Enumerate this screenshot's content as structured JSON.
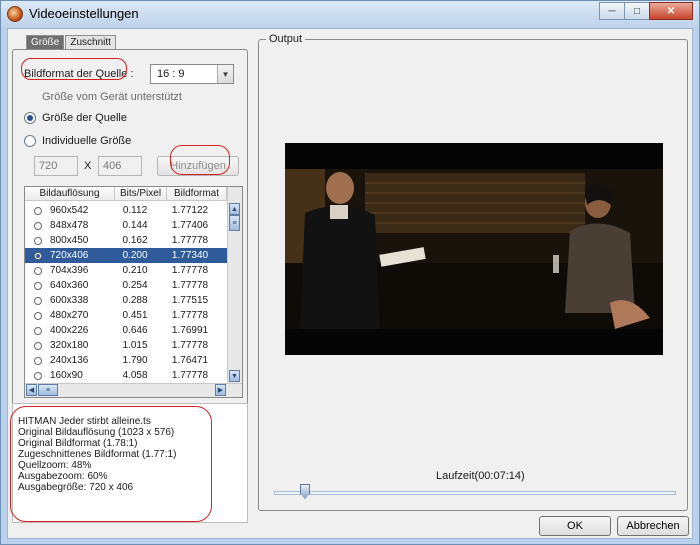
{
  "window": {
    "title": "Videoeinstellungen",
    "buttons": {
      "minimize": "─",
      "maximize": "□",
      "close": "✕"
    }
  },
  "tabs": [
    {
      "label": "Größe",
      "active": true
    },
    {
      "label": "Zuschnitt",
      "active": false
    }
  ],
  "left": {
    "source_format_label": "Bildformat der Quelle :",
    "source_format_value": "16 : 9",
    "supported_note": "Größe vom Gerät unterstützt",
    "radio_source": "Größe der Quelle",
    "radio_custom": "Individuelle Größe",
    "width_value": "720",
    "x_label": "X",
    "height_value": "406",
    "add_button": "Hinzufügen"
  },
  "table": {
    "headers": [
      "Bildauflösung",
      "Bits/Pixel",
      "Bildformat"
    ],
    "rows": [
      [
        "960x542",
        "0.112",
        "1.77122"
      ],
      [
        "848x478",
        "0.144",
        "1.77406"
      ],
      [
        "800x450",
        "0.162",
        "1.77778"
      ],
      [
        "720x406",
        "0.200",
        "1.77340"
      ],
      [
        "704x396",
        "0.210",
        "1.77778"
      ],
      [
        "640x360",
        "0.254",
        "1.77778"
      ],
      [
        "600x338",
        "0.288",
        "1.77515"
      ],
      [
        "480x270",
        "0.451",
        "1.77778"
      ],
      [
        "400x226",
        "0.646",
        "1.76991"
      ],
      [
        "320x180",
        "1.015",
        "1.77778"
      ],
      [
        "240x136",
        "1.790",
        "1.76471"
      ],
      [
        "160x90",
        "4.058",
        "1.77778"
      ]
    ],
    "selected_index": 3
  },
  "info": [
    "HITMAN Jeder stirbt alleine.ts",
    "Original Bildauflösung  (1023 x 576)",
    "Original Bildformat  (1.78:1)",
    "Zugeschnittenes Bildformat (1.77:1)",
    "Quellzoom:  48%",
    "Ausgabezoom:  60%",
    "Ausgabegröße:  720 x 406"
  ],
  "output": {
    "title": "Output",
    "time_label": "Laufzeit(00:07:14)"
  },
  "footer": {
    "ok": "OK",
    "cancel": "Abbrechen"
  }
}
